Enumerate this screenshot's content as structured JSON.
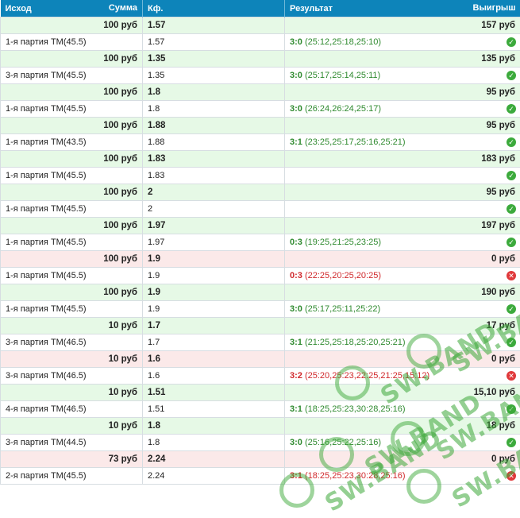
{
  "header": {
    "col_outcome": "Исход",
    "col_amount": "Сумма",
    "col_kf": "Кф.",
    "col_result": "Результат",
    "col_winnings": "Выигрыш"
  },
  "bets": [
    {
      "amount": "100 руб",
      "kf": "1.57",
      "payout": "157 руб",
      "outcome": "1-я партия ТМ(45.5)",
      "kf2": "1.57",
      "score": "3:0",
      "sets": " (25:12,25:18,25:10)",
      "status": "win"
    },
    {
      "amount": "100 руб",
      "kf": "1.35",
      "payout": "135 руб",
      "outcome": "3-я партия ТМ(45.5)",
      "kf2": "1.35",
      "score": "3:0",
      "sets": " (25:17,25:14,25:11)",
      "status": "win"
    },
    {
      "amount": "100 руб",
      "kf": "1.8",
      "payout": "95 руб",
      "outcome": "1-я партия ТМ(45.5)",
      "kf2": "1.8",
      "score": "3:0",
      "sets": " (26:24,26:24,25:17)",
      "status": "win"
    },
    {
      "amount": "100 руб",
      "kf": "1.88",
      "payout": "95 руб",
      "outcome": "1-я партия ТМ(43.5)",
      "kf2": "1.88",
      "score": "3:1",
      "sets": " (23:25,25:17,25:16,25:21)",
      "status": "win"
    },
    {
      "amount": "100 руб",
      "kf": "1.83",
      "payout": "183 руб",
      "outcome": "1-я партия ТМ(45.5)",
      "kf2": "1.83",
      "score": "",
      "sets": "",
      "status": "win"
    },
    {
      "amount": "100 руб",
      "kf": "2",
      "payout": "95 руб",
      "outcome": "1-я партия ТМ(45.5)",
      "kf2": "2",
      "score": "",
      "sets": "",
      "status": "win"
    },
    {
      "amount": "100 руб",
      "kf": "1.97",
      "payout": "197 руб",
      "outcome": "1-я партия ТМ(45.5)",
      "kf2": "1.97",
      "score": "0:3",
      "sets": " (19:25,21:25,23:25)",
      "status": "win"
    },
    {
      "amount": "100 руб",
      "kf": "1.9",
      "payout": "0 руб",
      "outcome": "1-я партия ТМ(45.5)",
      "kf2": "1.9",
      "score": "0:3",
      "sets": " (22:25,20:25,20:25)",
      "status": "loss"
    },
    {
      "amount": "100 руб",
      "kf": "1.9",
      "payout": "190 руб",
      "outcome": "1-я партия ТМ(45.5)",
      "kf2": "1.9",
      "score": "3:0",
      "sets": " (25:17,25:11,25:22)",
      "status": "win"
    },
    {
      "amount": "10 руб",
      "kf": "1.7",
      "payout": "17 руб",
      "outcome": "3-я партия ТМ(46.5)",
      "kf2": "1.7",
      "score": "3:1",
      "sets": " (21:25,25:18,25:20,25:21)",
      "status": "win"
    },
    {
      "amount": "10 руб",
      "kf": "1.6",
      "payout": "0 руб",
      "outcome": "3-я партия ТМ(46.5)",
      "kf2": "1.6",
      "score": "3:2",
      "sets": " (25:20,25:23,22:25,21:25,15:12)",
      "status": "loss"
    },
    {
      "amount": "10 руб",
      "kf": "1.51",
      "payout": "15,10 руб",
      "outcome": "4-я партия ТМ(46.5)",
      "kf2": "1.51",
      "score": "3:1",
      "sets": " (18:25,25:23,30:28,25:16)",
      "status": "win"
    },
    {
      "amount": "10 руб",
      "kf": "1.8",
      "payout": "18 руб",
      "outcome": "3-я партия ТМ(44.5)",
      "kf2": "1.8",
      "score": "3:0",
      "sets": " (25:16,25:22,25:16)",
      "status": "win"
    },
    {
      "amount": "73 руб",
      "kf": "2.24",
      "payout": "0 руб",
      "outcome": "2-я партия ТМ(45.5)",
      "kf2": "2.24",
      "score": "3:1",
      "sets": " (18:25,25:23,30:28,25:16)",
      "status": "loss"
    }
  ],
  "watermark": "SW.BAND",
  "colors": {
    "header": "#0d84ba",
    "win_row": "#e6f9e6",
    "loss_row": "#fbe9e9",
    "win_text": "#2f8a2f",
    "loss_text": "#d0282b"
  }
}
